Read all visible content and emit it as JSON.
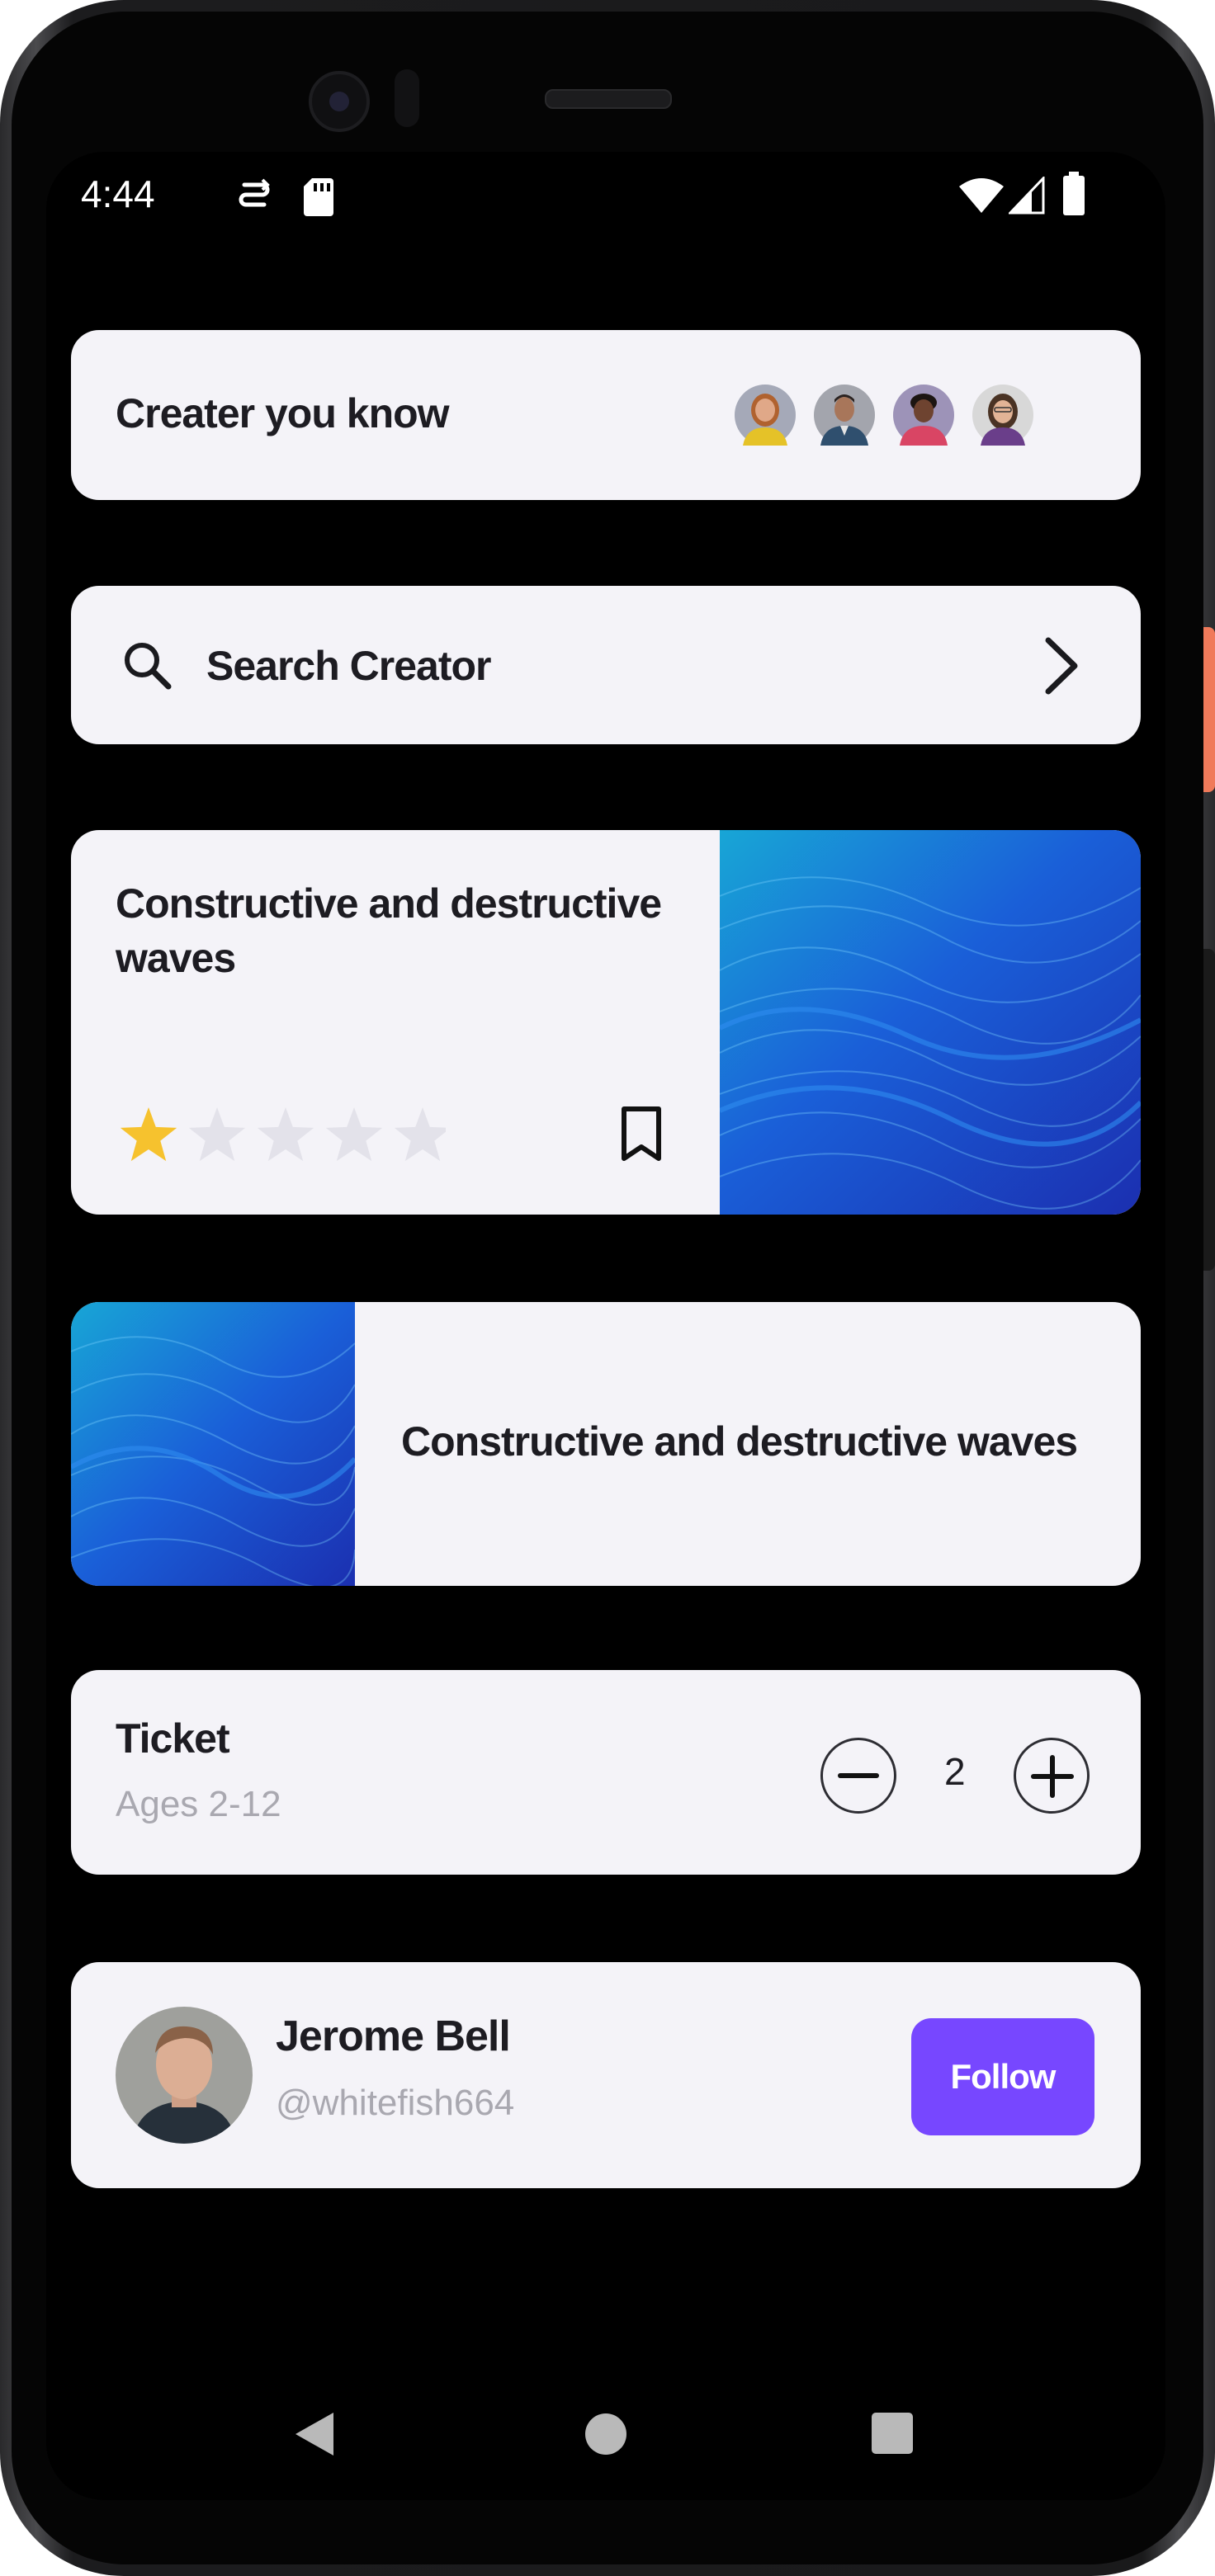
{
  "status_bar": {
    "time": "4:44",
    "icons": [
      "sync-icon",
      "sd-card-icon",
      "wifi-icon",
      "signal-icon",
      "battery-icon"
    ]
  },
  "creators_card": {
    "title": "Creater you know",
    "avatars": [
      "creator-avatar-1",
      "creator-avatar-2",
      "creator-avatar-3",
      "creator-avatar-4"
    ]
  },
  "search_card": {
    "label": "Search Creator"
  },
  "article_card": {
    "title": "Constructive and destructive waves",
    "rating": 1,
    "rating_max": 5,
    "star_color": "#f6c22e",
    "empty_star_color": "#e3e2ea"
  },
  "article_row": {
    "title": "Constructive and destructive waves"
  },
  "ticket_card": {
    "title": "Ticket",
    "subtitle": "Ages 2-12",
    "quantity": "2"
  },
  "profile_card": {
    "name": "Jerome Bell",
    "handle": "@whitefish664",
    "follow_label": "Follow",
    "accent": "#7747ff"
  },
  "nav_bar": {
    "items": [
      "back-icon",
      "home-icon",
      "recents-icon"
    ]
  }
}
